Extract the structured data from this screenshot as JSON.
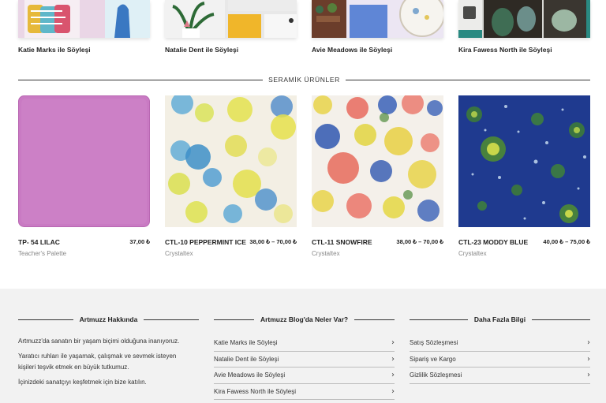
{
  "blog_posts": [
    {
      "title": "Katie Marks ile Söyleşi",
      "thumb_icon": "ceramic-mugs-photo"
    },
    {
      "title": "Natalie Dent ile Söyleşi",
      "thumb_icon": "studio-plant-photo"
    },
    {
      "title": "Avie Meadows ile Söyleşi",
      "thumb_icon": "glazed-plate-photo"
    },
    {
      "title": "Kira Fawess North ile Söyleşi",
      "thumb_icon": "ceramic-jars-photo"
    }
  ],
  "section": {
    "products_heading": "SERAMİK ÜRÜNLER"
  },
  "products": [
    {
      "name": "TP- 54 LILAC",
      "price": "37,00 ₺",
      "brand": "Teacher's Palette",
      "color": "#c97ac3"
    },
    {
      "name": "CTL-10 PEPPERMINT ICE",
      "price": "38,00 ₺ – 70,00 ₺",
      "brand": "Crystaltex",
      "color": "#f1ede2"
    },
    {
      "name": "CTL-11 SNOWFIRE",
      "price": "38,00 ₺ – 70,00 ₺",
      "brand": "Crystaltex",
      "color": "#f4f0ea"
    },
    {
      "name": "CTL-23 MODDY BLUE",
      "price": "40,00 ₺ – 75,00 ₺",
      "brand": "Crystaltex",
      "color": "#1f3a8f"
    }
  ],
  "footer": {
    "about": {
      "heading": "Artmuzz Hakkında",
      "paragraph_1": "Artmuzz'da sanatın bir yaşam biçimi olduğuna inanıyoruz.",
      "paragraph_2_line_1": "Yaratıcı ruhları ile yaşamak, çalışmak ve sevmek isteyen",
      "paragraph_2_line_2": "kişileri teşvik etmek en büyük tutkumuz.",
      "paragraph_3": "İçinizdeki sanatçıyı keşfetmek için bize katılın."
    },
    "blog": {
      "heading": "Artmuzz Blog'da Neler Var?",
      "links": [
        "Katie Marks ile Söyleşi",
        "Natalie Dent ile Söyleşi",
        "Avie Meadows ile Söyleşi",
        "Kira Fawess North ile Söyleşi"
      ]
    },
    "info": {
      "heading": "Daha Fazla Bilgi",
      "links": [
        "Satış Sözleşmesi",
        "Sipariş ve Kargo",
        "Gizlilik Sözleşmesi"
      ]
    },
    "chevron": "›"
  }
}
